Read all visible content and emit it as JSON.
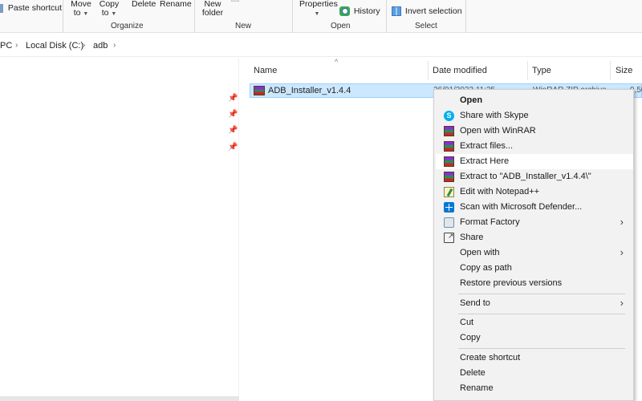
{
  "ribbon": {
    "clipboard": {
      "paste_shortcut": "Paste shortcut"
    },
    "organize": {
      "move_to": "Move",
      "move_to_2": "to",
      "copy_to": "Copy",
      "copy_to_2": "to",
      "delete": "Delete",
      "rename": "Rename",
      "group_label": "Organize"
    },
    "new": {
      "new_folder": "New",
      "new_folder_2": "folder",
      "group_label": "New"
    },
    "open": {
      "properties": "Properties",
      "history": "History",
      "group_label": "Open"
    },
    "select": {
      "invert_selection": "Invert selection",
      "group_label": "Select"
    }
  },
  "address": {
    "crumbs": [
      "PC",
      "Local Disk (C:)",
      "adb"
    ]
  },
  "columns": {
    "name": "Name",
    "date_modified": "Date modified",
    "type": "Type",
    "size": "Size"
  },
  "file": {
    "name": "ADB_Installer_v1.4.4",
    "date_fragment": "26/01/2023 11:35",
    "type_fragment": "WinRAR ZIP archive",
    "size_fragment": "9,50"
  },
  "context_menu": {
    "items": [
      {
        "label": "Open",
        "icon": "none"
      },
      {
        "label": "Share with Skype",
        "icon": "skype-icon"
      },
      {
        "label": "Open with WinRAR",
        "icon": "winrar-icon"
      },
      {
        "label": "Extract files...",
        "icon": "winrar-icon"
      },
      {
        "label": "Extract Here",
        "icon": "winrar-icon"
      },
      {
        "label": "Extract to \"ADB_Installer_v1.4.4\\\"",
        "icon": "winrar-icon"
      },
      {
        "label": "Edit with Notepad++",
        "icon": "notepad-plus-icon"
      },
      {
        "label": "Scan with Microsoft Defender...",
        "icon": "defender-icon"
      },
      {
        "label": "Format Factory",
        "icon": "format-factory-icon"
      },
      {
        "label": "Share",
        "icon": "share-icon"
      },
      {
        "label": "Open with",
        "icon": "none"
      },
      {
        "label": "Copy as path",
        "icon": "none"
      },
      {
        "label": "Restore previous versions",
        "icon": "none"
      },
      {
        "label": "Send to",
        "icon": "none"
      },
      {
        "label": "Cut",
        "icon": "none"
      },
      {
        "label": "Copy",
        "icon": "none"
      },
      {
        "label": "Create shortcut",
        "icon": "none"
      },
      {
        "label": "Delete",
        "icon": "none"
      },
      {
        "label": "Rename",
        "icon": "none"
      }
    ]
  },
  "colors": {
    "selection_bg": "#cce8ff",
    "selection_border": "#99d1ff",
    "menu_bg": "#f2f2f2",
    "menu_hover": "#ffffff",
    "accent_blue": "#0078d4"
  }
}
